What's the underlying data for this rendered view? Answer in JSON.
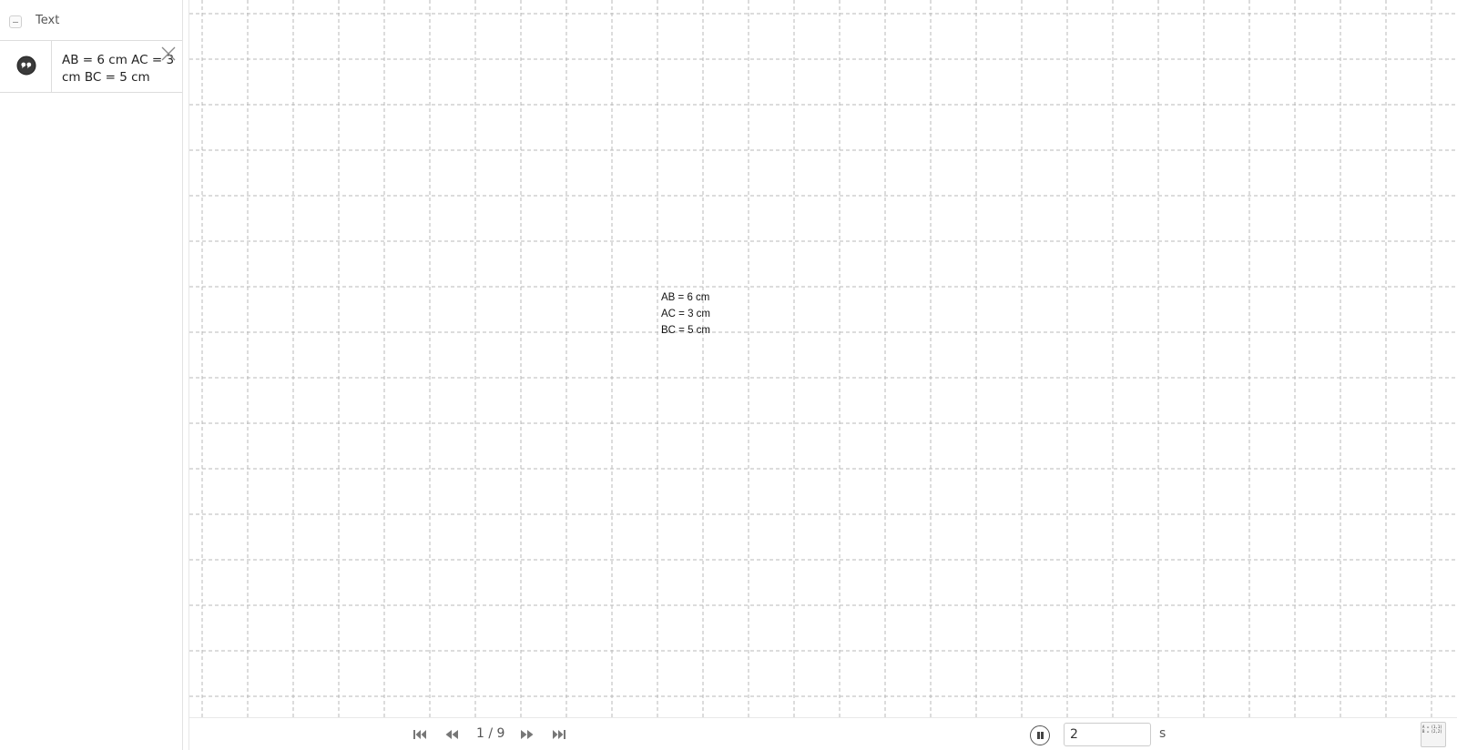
{
  "sidebar": {
    "title": "Text",
    "item": {
      "text": "AB = 6 cm AC = 3 cm BC = 5 cm"
    }
  },
  "canvas": {
    "lines": [
      "AB = 6 cm",
      "AC = 3 cm",
      "BC = 5 cm"
    ]
  },
  "player": {
    "page_indicator": "1 / 9",
    "speed_value": "2",
    "speed_unit": "s",
    "table_button": {
      "line1": "A = (1,1)",
      "line2": "B = (2,2)"
    }
  },
  "colors": {
    "grid_line": "#b8b8b8",
    "divider": "#e2e2e2",
    "icon_dark": "#333333"
  }
}
